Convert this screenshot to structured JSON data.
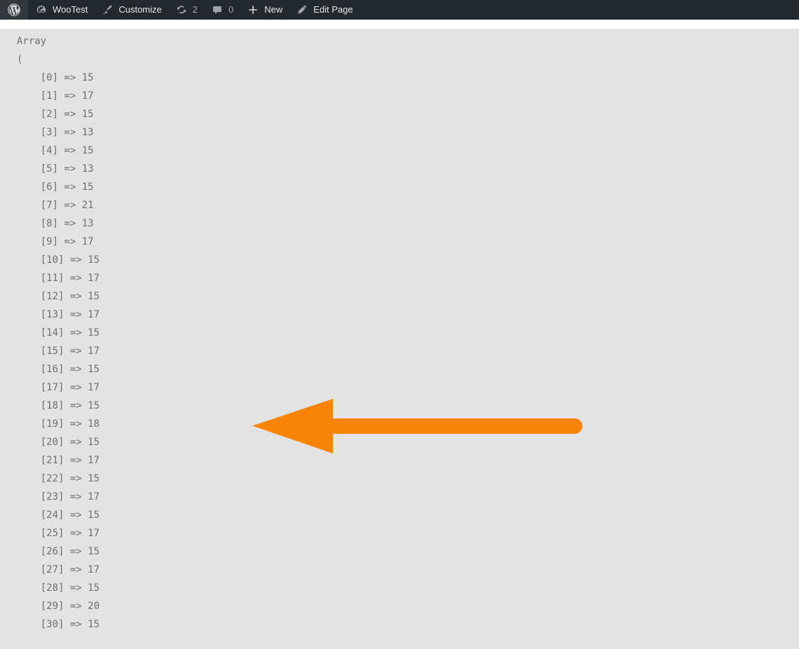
{
  "adminbar": {
    "items": [
      {
        "name": "wp-logo",
        "icon": "wordpress-logo-icon",
        "label": "",
        "count": ""
      },
      {
        "name": "site-name",
        "icon": "dashboard-icon",
        "label": "WooTest",
        "count": ""
      },
      {
        "name": "customize",
        "icon": "paintbrush-icon",
        "label": "Customize",
        "count": ""
      },
      {
        "name": "updates",
        "icon": "update-arrows-icon",
        "label": "",
        "count": "2"
      },
      {
        "name": "comments",
        "icon": "comment-bubble-icon",
        "label": "",
        "count": "0"
      },
      {
        "name": "new-content",
        "icon": "plus-icon",
        "label": "New",
        "count": ""
      },
      {
        "name": "edit-page",
        "icon": "pencil-icon",
        "label": "Edit Page",
        "count": ""
      }
    ]
  },
  "output": {
    "header": "Array",
    "open_bracket": "(",
    "arrow": "=>",
    "entries": [
      {
        "index": "0",
        "value": "15"
      },
      {
        "index": "1",
        "value": "17"
      },
      {
        "index": "2",
        "value": "15"
      },
      {
        "index": "3",
        "value": "13"
      },
      {
        "index": "4",
        "value": "15"
      },
      {
        "index": "5",
        "value": "13"
      },
      {
        "index": "6",
        "value": "15"
      },
      {
        "index": "7",
        "value": "21"
      },
      {
        "index": "8",
        "value": "13"
      },
      {
        "index": "9",
        "value": "17"
      },
      {
        "index": "10",
        "value": "15"
      },
      {
        "index": "11",
        "value": "17"
      },
      {
        "index": "12",
        "value": "15"
      },
      {
        "index": "13",
        "value": "17"
      },
      {
        "index": "14",
        "value": "15"
      },
      {
        "index": "15",
        "value": "17"
      },
      {
        "index": "16",
        "value": "15"
      },
      {
        "index": "17",
        "value": "17"
      },
      {
        "index": "18",
        "value": "15"
      },
      {
        "index": "19",
        "value": "18"
      },
      {
        "index": "20",
        "value": "15"
      },
      {
        "index": "21",
        "value": "17"
      },
      {
        "index": "22",
        "value": "15"
      },
      {
        "index": "23",
        "value": "17"
      },
      {
        "index": "24",
        "value": "15"
      },
      {
        "index": "25",
        "value": "17"
      },
      {
        "index": "26",
        "value": "15"
      },
      {
        "index": "27",
        "value": "17"
      },
      {
        "index": "28",
        "value": "15"
      },
      {
        "index": "29",
        "value": "20"
      },
      {
        "index": "30",
        "value": "15"
      }
    ]
  },
  "annotation": {
    "name": "left-pointing-arrow",
    "color": "#f98508",
    "direction": "left"
  },
  "colors": {
    "adminbar_bg": "#23282d",
    "adminbar_text": "#e8eaeb",
    "adminbar_muted": "#a0a5aa",
    "page_bg": "#ffffff",
    "content_bg": "#e3e3e3",
    "code_text": "#6f6f6f",
    "accent_orange": "#f98508"
  }
}
